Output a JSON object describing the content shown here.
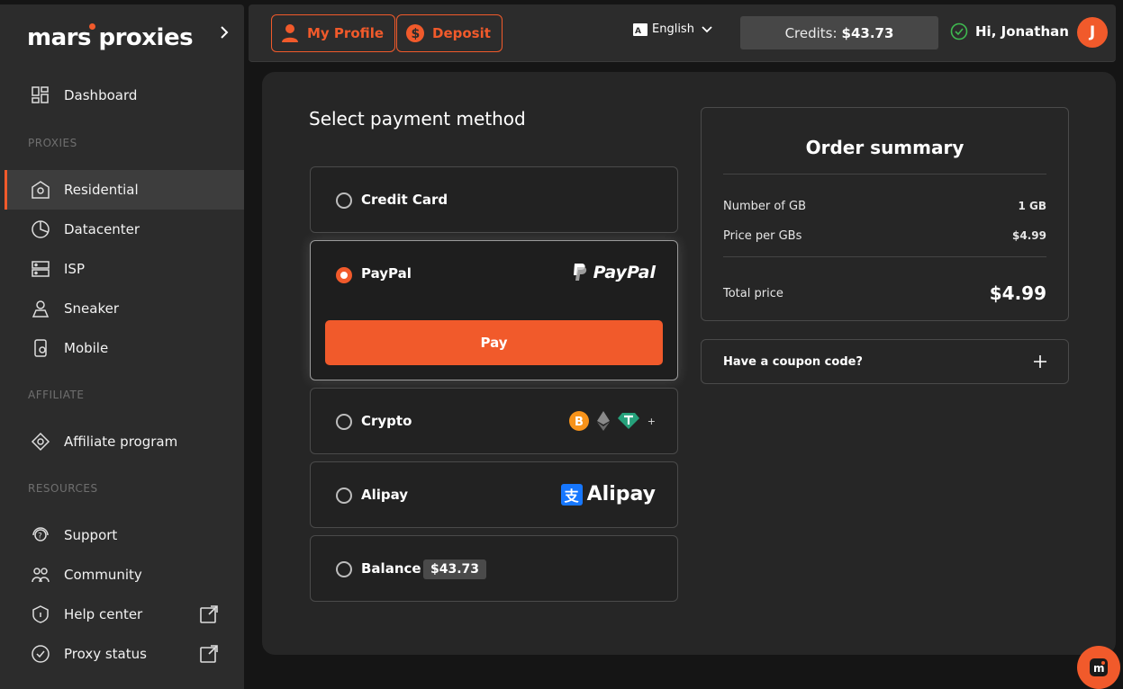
{
  "brand": {
    "logo_text": "mars proxies"
  },
  "sidebar": {
    "dashboard": "Dashboard",
    "sections": {
      "proxies": "PROXIES",
      "affiliate": "AFFILIATE",
      "resources": "RESOURCES"
    },
    "items": {
      "residential": "Residential",
      "datacenter": "Datacenter",
      "isp": "ISP",
      "sneaker": "Sneaker",
      "mobile": "Mobile",
      "affiliate": "Affiliate program",
      "support": "Support",
      "community": "Community",
      "help": "Help center",
      "status": "Proxy status"
    }
  },
  "topbar": {
    "profile": "My Profile",
    "deposit": "Deposit",
    "language": "English",
    "credits_label": "Credits:",
    "credits_value": "$43.73",
    "greeting": "Hi, Jonathan",
    "avatar_initial": "J"
  },
  "payment": {
    "title": "Select payment method",
    "credit_card": "Credit Card",
    "paypal": "PayPal",
    "paypal_logo": "PayPal",
    "pay": "Pay",
    "crypto": "Crypto",
    "crypto_more": "+",
    "alipay": "Alipay",
    "alipay_logo": "Alipay",
    "alipay_glyph": "支",
    "balance": "Balance",
    "balance_value": "$43.73"
  },
  "summary": {
    "title": "Order summary",
    "gb_label": "Number of GB",
    "gb_value": "1 GB",
    "price_label": "Price per GBs",
    "price_value": "$4.99",
    "total_label": "Total price",
    "total_value": "$4.99",
    "coupon": "Have a coupon code?"
  },
  "colors": {
    "accent": "#f15a2b",
    "sidebar": "#2c2c2c",
    "panel": "#262626",
    "bg": "#151515"
  }
}
